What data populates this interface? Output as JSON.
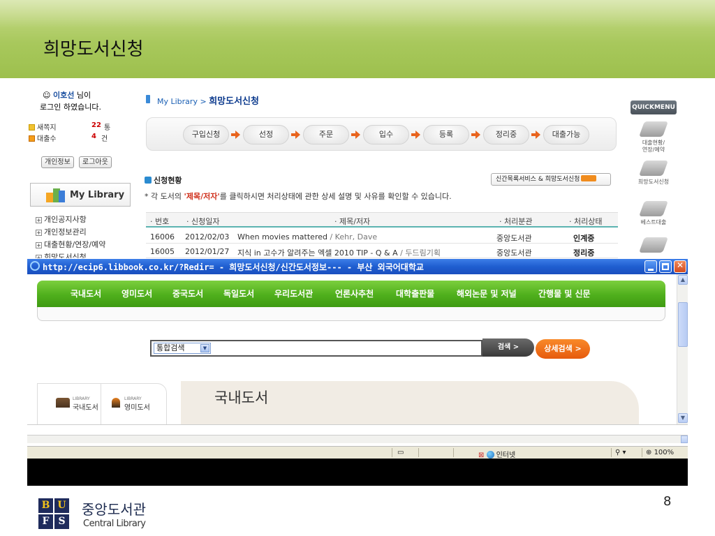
{
  "slide": {
    "title": "희망도서신청",
    "page_number": "8",
    "logo": {
      "letters": [
        "B",
        "U",
        "F",
        "S"
      ],
      "name_ko": "중앙도서관",
      "name_en": "Central Library"
    },
    "colors": {
      "header_green": "#9dc04d",
      "nav_green": "#4faf1c",
      "orange": "#e65a0c",
      "xp_blue": "#1f5ed0"
    }
  },
  "back_page": {
    "user": {
      "name": "이호선",
      "suffix": "님이",
      "line2": "로그인 하였습니다."
    },
    "messages": [
      {
        "label": "새쪽지",
        "count": "22",
        "unit": "통"
      },
      {
        "label": "대출수",
        "count": "4",
        "unit": "건"
      }
    ],
    "buttons": {
      "profile": "개인정보",
      "logout": "로그아웃"
    },
    "my_library": "My Library",
    "left_nav": [
      "개인공지사항",
      "개인정보관리",
      "대출현황/연장/예약",
      "희망도서신청"
    ],
    "breadcrumb": {
      "root": "My Library >",
      "current": "희망도서신청"
    },
    "process_steps": [
      "구입신청",
      "선정",
      "주문",
      "입수",
      "등록",
      "정리중",
      "대출가능"
    ],
    "status_heading": "신청현황",
    "new_books_button": "신간목록서비스 & 희망도서신청",
    "notice": {
      "prefix": "* 각 도서의 ",
      "highlight": "'제목/저자'",
      "suffix": "를 클릭하시면 처리상태에 관한 상세 설명 및 사유를 확인할 수 있습니다."
    },
    "table": {
      "headers": [
        "· 번호",
        "· 신청일자",
        "· 제목/저자",
        "· 처리분관",
        "· 처리상태"
      ],
      "rows": [
        {
          "no": "16006",
          "date": "2012/02/03",
          "title": "When movies mattered",
          "author": " / Kehr, Dave",
          "branch": "중앙도서관",
          "status": "인계중"
        },
        {
          "no": "16005",
          "date": "2012/01/27",
          "title": "지식 in 고수가 알려주는 엑셀 2010 TIP - Q & A",
          "author": " / 두드림기획",
          "branch": "중앙도서관",
          "status": "정리중"
        }
      ]
    },
    "quickmenu": {
      "title": "QUICKMENU",
      "items": [
        "대출현황/\n연장/예약",
        "희망도서신청",
        "베스트대출"
      ]
    }
  },
  "ie_window": {
    "title": "http://ecip6.libbook.co.kr/?Redir= - 희망도서신청/신간도서정보--- - 부산 외국어대학교",
    "nav": [
      "국내도서",
      "영미도서",
      "중국도서",
      "독일도서",
      "우리도서관",
      "언론사추천",
      "대학출판물",
      "해외논문 및 저널",
      "간행물 및 신문"
    ],
    "search": {
      "select_value": "통합검색",
      "button": "검색 >",
      "advanced": "상세검색 >"
    },
    "lib_tabs": [
      {
        "small": "LIBRARY",
        "label": "국내도서"
      },
      {
        "small": "LIBRARY",
        "label": "영미도서"
      }
    ],
    "panel_title": "국내도서",
    "statusbar": {
      "zone": "인터넷",
      "zoom": "100%"
    }
  }
}
